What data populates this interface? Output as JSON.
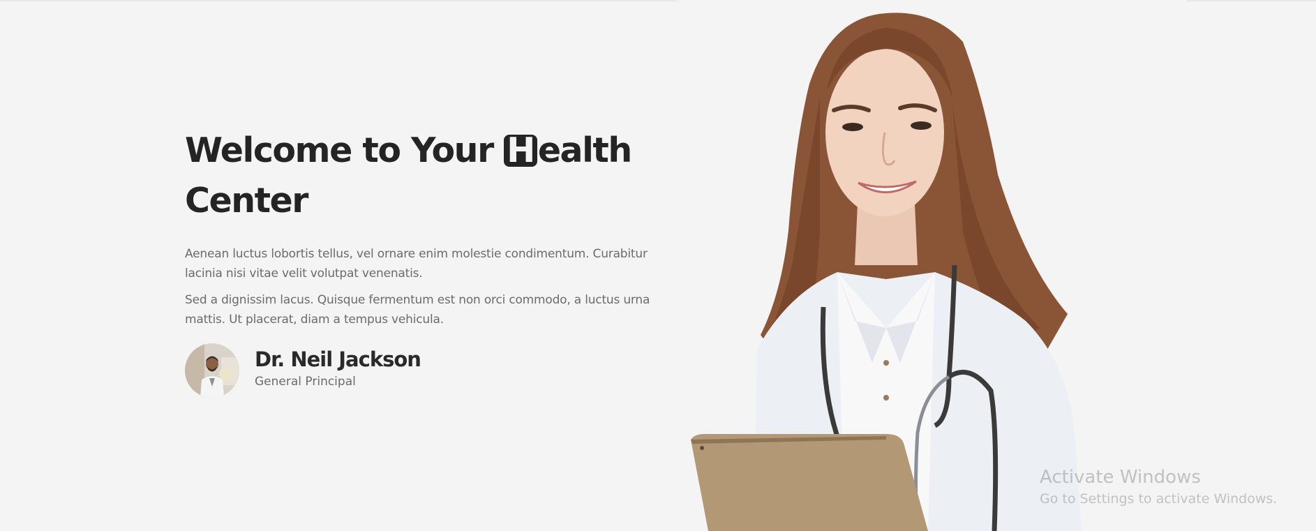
{
  "hero": {
    "title_pre": "Welcome to Your",
    "title_h": "H",
    "title_rest": "ealth",
    "title_line2": "Center",
    "paragraphs": [
      "Aenean luctus lobortis tellus, vel ornare enim molestie condimentum. Curabitur lacinia nisi vitae velit volutpat venenatis.",
      "Sed a dignissim lacus. Quisque fermentum est non orci commodo, a luctus urna mattis. Ut placerat, diam a tempus vehicula."
    ]
  },
  "author": {
    "name": "Dr. Neil Jackson",
    "role": "General Principal"
  },
  "watermark": {
    "title": "Activate Windows",
    "subtitle": "Go to Settings to activate Windows."
  },
  "colors": {
    "background": "#f4f4f4",
    "heading": "#242424",
    "body_text": "#6b6b6b"
  }
}
